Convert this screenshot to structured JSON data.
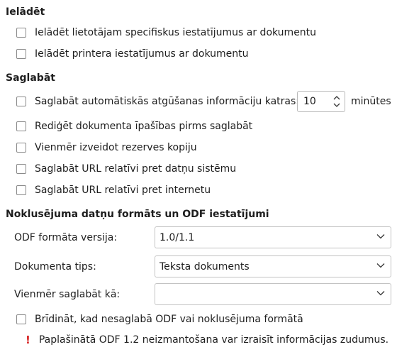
{
  "load": {
    "title": "Ielādēt",
    "options": [
      {
        "label": "Ielādēt lietotājam specifiskus iestatījumus ar dokumentu",
        "checked": false
      },
      {
        "label": "Ielādēt printera iestatījumus ar dokumentu",
        "checked": false
      }
    ]
  },
  "save": {
    "title": "Saglabāt",
    "autorecovery": {
      "label": "Saglabāt automātiskās atgūšanas informāciju katras:",
      "value": "10",
      "unit": "minūtes",
      "checked": false
    },
    "options": [
      {
        "label": "Rediģēt dokumenta īpašības pirms saglabāt",
        "checked": false
      },
      {
        "label": "Vienmēr izveidot rezerves kopiju",
        "checked": false
      },
      {
        "label": "Saglabāt URL relatīvi pret datņu sistēmu",
        "checked": false
      },
      {
        "label": "Saglabāt URL relatīvi pret internetu",
        "checked": false
      }
    ]
  },
  "odf": {
    "title": "Noklusējuma datņu formāts un ODF iestatījumi",
    "version": {
      "label": "ODF formāta versija:",
      "value": "1.0/1.1"
    },
    "doc_type": {
      "label": "Dokumenta tips:",
      "value": "Teksta dokuments"
    },
    "always_save_as": {
      "label": "Vienmēr saglabāt kā:",
      "value": ""
    },
    "warn": {
      "label": "Brīdināt, kad nesaglabā ODF vai noklusējuma formātā",
      "checked": false
    },
    "notice": "Paplašinātā ODF 1.2 neizmantošana var izraisīt informācijas zudumus."
  },
  "colors": {
    "text": "#1e1e1e",
    "warning": "#d61f1f",
    "border": "#8a8a8a"
  },
  "icons": {
    "spin": "spinner-arrows-icon",
    "dropdown": "chevron-down-icon",
    "warning": "exclamation-icon"
  }
}
